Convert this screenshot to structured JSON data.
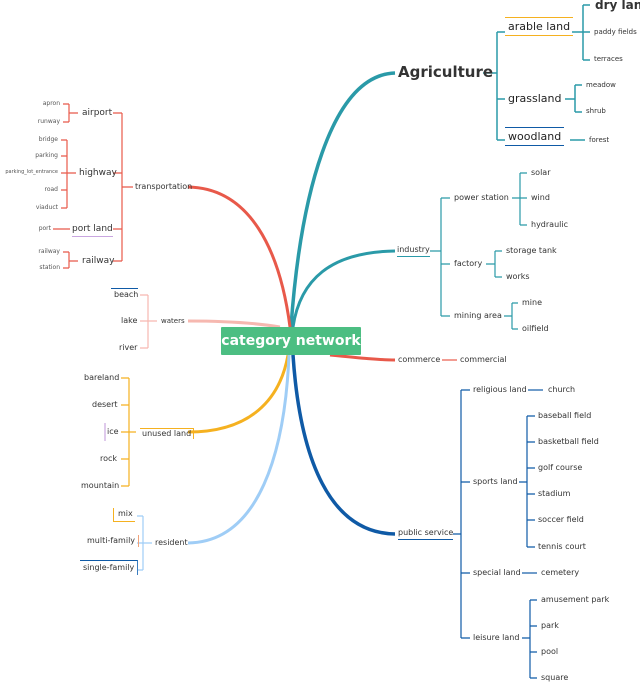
{
  "root": {
    "label": "category network",
    "color": "#4cbe82"
  },
  "colors": {
    "agriculture": "#2a9aa8",
    "industry": "#2a9aa8",
    "transportation": "#e8594a",
    "water": "#f6b8b0",
    "commerce": "#e8594a",
    "unused": "#f5b120",
    "resident": "#9fcdf6",
    "public": "#0f5aa6"
  },
  "agriculture": {
    "label": "Agriculture",
    "arable": {
      "label": "arable land",
      "children": [
        "dry land",
        "paddy fields",
        "terraces"
      ]
    },
    "grassland": {
      "label": "grassland",
      "children": [
        "meadow",
        "shrub"
      ]
    },
    "woodland": {
      "label": "woodland",
      "children": [
        "forest"
      ]
    }
  },
  "industry": {
    "label": "industry",
    "power": {
      "label": "power station",
      "children": [
        "solar",
        "wind",
        "hydraulic"
      ]
    },
    "factory": {
      "label": "factory",
      "children": [
        "storage tank",
        "works"
      ]
    },
    "mining": {
      "label": "mining area",
      "children": [
        "mine",
        "oilfield"
      ]
    }
  },
  "commerce": {
    "label": "commerce",
    "children": [
      "commercial"
    ]
  },
  "public": {
    "label": "public service",
    "religious": {
      "label": "religious land",
      "children": [
        "church"
      ]
    },
    "sports": {
      "label": "sports land",
      "children": [
        "baseball field",
        "basketball field",
        "golf course",
        "stadium",
        "soccer field",
        "tennis court"
      ]
    },
    "special": {
      "label": "special land",
      "children": [
        "cemetery"
      ]
    },
    "leisure": {
      "label": "leisure land",
      "children": [
        "amusement park",
        "park",
        "pool",
        "square"
      ]
    }
  },
  "transportation": {
    "label": "transportation",
    "airport": {
      "label": "airport",
      "children": [
        "apron",
        "runway"
      ]
    },
    "highway": {
      "label": "highway",
      "children": [
        "bridge",
        "parking",
        "parking_lot_entrance",
        "road",
        "viaduct"
      ]
    },
    "port": {
      "label": "port land",
      "children": [
        "port"
      ]
    },
    "railway": {
      "label": "railway",
      "children": [
        "railway",
        "station"
      ]
    }
  },
  "water": {
    "label": "waters",
    "children": [
      "beach",
      "lake",
      "river"
    ]
  },
  "unused": {
    "label": "unused land",
    "children": [
      "bareland",
      "desert",
      "ice",
      "rock",
      "mountain"
    ]
  },
  "resident": {
    "label": "resident",
    "children": [
      "mix",
      "multi-family",
      "single-family"
    ]
  }
}
